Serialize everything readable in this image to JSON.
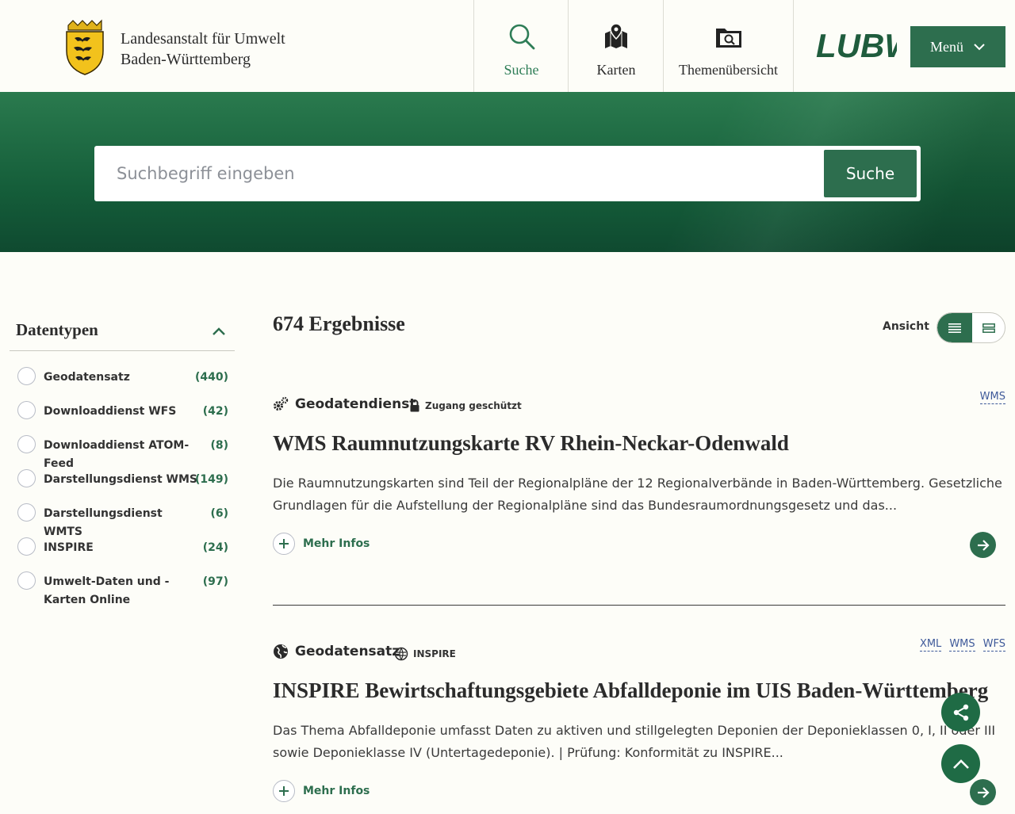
{
  "header": {
    "org_line1": "Landesanstalt für Umwelt",
    "org_line2": "Baden-Württemberg",
    "nav": [
      {
        "label": "Suche",
        "icon": "search-icon"
      },
      {
        "label": "Karten",
        "icon": "map-icon"
      },
      {
        "label": "Themenübersicht",
        "icon": "folder-search-icon"
      }
    ],
    "logo_text": "LUBW",
    "menu_label": "Menü"
  },
  "search": {
    "placeholder": "Suchbegriff eingeben",
    "button_label": "Suche"
  },
  "sidebar": {
    "title": "Datentypen",
    "items": [
      {
        "label": "Geodatensatz",
        "count": "(440)"
      },
      {
        "label": "Downloaddienst WFS",
        "count": "(42)"
      },
      {
        "label": "Downloaddienst ATOM-Feed",
        "count": "(8)"
      },
      {
        "label": "Darstellungsdienst WMS",
        "count": "(149)"
      },
      {
        "label": "Darstellungsdienst WMTS",
        "count": "(6)"
      },
      {
        "label": "INSPIRE",
        "count": "(24)"
      },
      {
        "label": "Umwelt-Daten und -Karten Online",
        "count": "(97)"
      }
    ]
  },
  "results": {
    "count_label": "674 Ergebnisse",
    "view_label": "Ansicht",
    "items": [
      {
        "type": "Geodatendienst",
        "badge": "Zugang geschützt",
        "formats": [
          "WMS"
        ],
        "title": "WMS Raumnutzungskarte RV Rhein-Neckar-Odenwald",
        "description": "Die Raumnutzungskarten sind Teil der Regionalpläne der 12 Regionalverbände in Baden-Württemberg. Gesetzliche Grundlagen für die Aufstellung der Regionalpläne sind das Bundesraumordnungsgesetz und das...",
        "more_label": "Mehr Infos"
      },
      {
        "type": "Geodatensatz",
        "badge": "INSPIRE",
        "formats": [
          "XML",
          "WMS",
          "WFS"
        ],
        "title": "INSPIRE Bewirtschaftungsgebiete Abfalldeponie im UIS Baden-Württemberg",
        "description": "Das Thema Abfalldeponie umfasst Daten zu aktiven und stillgelegten Deponien der Deponieklassen 0, I, II oder III sowie Deponieklasse IV (Untertagedeponie). | Prüfung: Konformität zu INSPIRE...",
        "more_label": "Mehr Infos"
      }
    ]
  },
  "colors": {
    "accent": "#2d6e4e",
    "hero_dark": "#0f4a30",
    "link": "#3f5a9a"
  }
}
